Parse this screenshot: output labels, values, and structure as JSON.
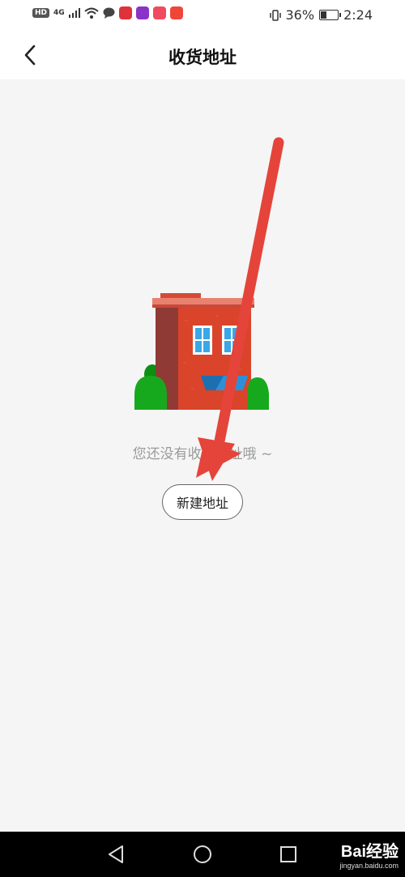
{
  "status_bar": {
    "hd": "HD",
    "network": "4G",
    "battery_percent": "36%",
    "battery_level": 0.36,
    "time": "2:24",
    "icons": [
      "hd-icon",
      "signal-icon",
      "wifi-icon",
      "chat-icon",
      "app-icon-red",
      "app-icon-purple",
      "app-icon-pink",
      "app-icon-orange",
      "vibrate-icon",
      "battery-icon"
    ]
  },
  "header": {
    "title": "收货地址",
    "back_icon": "chevron-left-icon"
  },
  "empty_state": {
    "illustration": "house-illustration",
    "message": "您还没有收货地址哦 ~",
    "button_label": "新建地址"
  },
  "annotation": {
    "icon": "red-arrow-icon",
    "color": "#e5443b"
  },
  "nav_bar": {
    "icons": [
      "back-triangle-icon",
      "home-circle-icon",
      "recents-square-icon"
    ]
  },
  "watermark": {
    "text": "Bai经验",
    "sub": "jingyan.baidu.com"
  },
  "colors": {
    "background": "#f5f5f5",
    "header_bg": "#ffffff",
    "house_brick": "#d9442a",
    "house_shadow": "#8f3a35",
    "bush": "#17a91d",
    "nav_bg": "#000000"
  }
}
